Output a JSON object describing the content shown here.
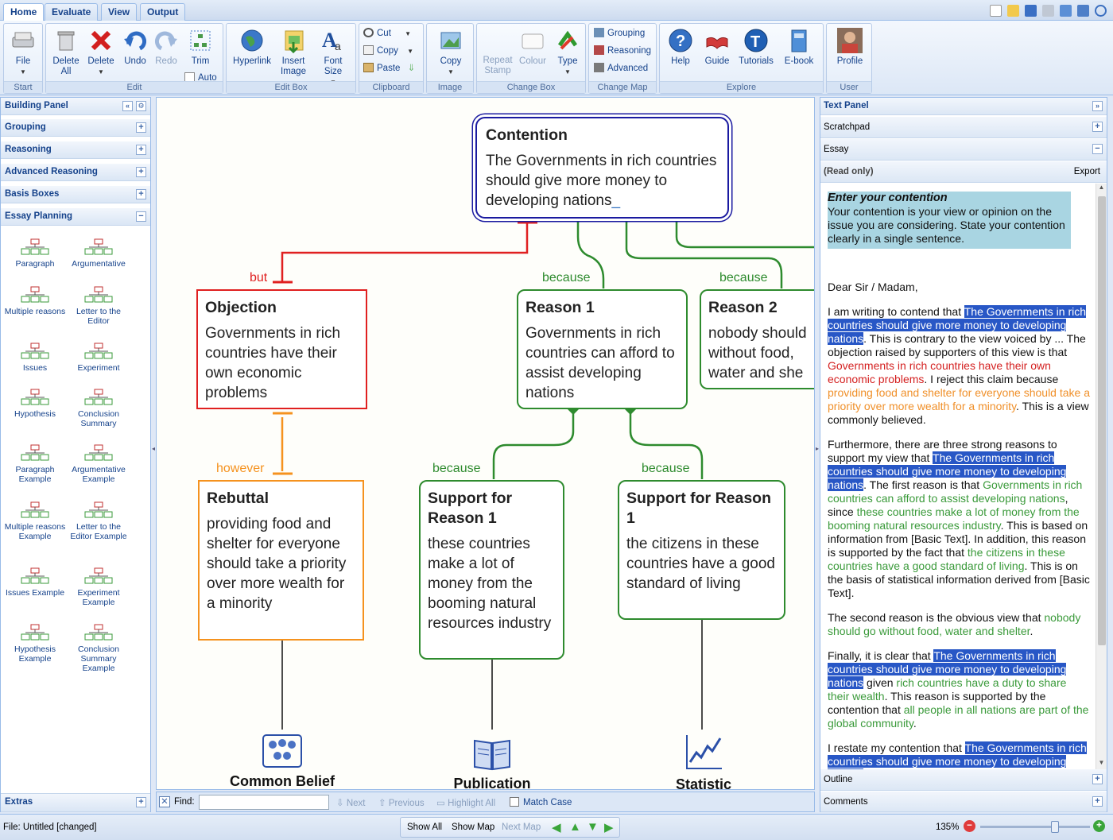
{
  "tabs": [
    "Home",
    "Evaluate",
    "View",
    "Output"
  ],
  "ribbon": {
    "start": {
      "title": "Start",
      "file": "File"
    },
    "edit": {
      "title": "Edit",
      "delete_all": "Delete All",
      "delete": "Delete",
      "undo": "Undo",
      "redo": "Redo",
      "trim": "Trim",
      "auto": "Auto"
    },
    "editbox": {
      "title": "Edit Box",
      "hyperlink": "Hyperlink",
      "insert_image": "Insert Image",
      "font_size": "Font Size"
    },
    "clipboard": {
      "title": "Clipboard",
      "cut": "Cut",
      "copy": "Copy",
      "paste": "Paste"
    },
    "image": {
      "title": "Image",
      "copy": "Copy"
    },
    "changebox": {
      "title": "Change Box",
      "repeat_stamp": "Repeat Stamp",
      "colour": "Colour",
      "type": "Type"
    },
    "changemap": {
      "title": "Change Map",
      "grouping": "Grouping",
      "reasoning": "Reasoning",
      "advanced": "Advanced"
    },
    "explore": {
      "title": "Explore",
      "help": "Help",
      "guide": "Guide",
      "tutorials": "Tutorials",
      "ebook": "E-book"
    },
    "user": {
      "title": "User",
      "profile": "Profile"
    }
  },
  "left_panel": {
    "title": "Building Panel",
    "sections": [
      "Grouping",
      "Reasoning",
      "Advanced Reasoning",
      "Basis Boxes",
      "Essay Planning"
    ],
    "templates": [
      "Paragraph",
      "Argumentative",
      "Multiple reasons",
      "Letter to the Editor",
      "Issues",
      "Experiment",
      "Hypothesis",
      "Conclusion Summary",
      "Paragraph Example",
      "Argumentative Example",
      "Multiple reasons Example",
      "Letter to the Editor Example",
      "Issues Example",
      "Experiment Example",
      "Hypothesis Example",
      "Conclusion Summary Example"
    ],
    "extras": "Extras"
  },
  "map": {
    "contention": {
      "title": "Contention",
      "text": "The Governments in rich countries should give more money to developing nations",
      "cursor": "_"
    },
    "objection": {
      "title": "Objection",
      "text": "Governments in rich countries have their own economic problems",
      "connector": "but"
    },
    "reason1": {
      "title": "Reason 1",
      "text": "Governments in rich countries can afford to assist developing nations",
      "connector": "because"
    },
    "reason2": {
      "title": "Reason 2",
      "text": "nobody should without food, water and she",
      "connector": "because"
    },
    "rebuttal": {
      "title": "Rebuttal",
      "text": "providing food and shelter for everyone should take a priority over more wealth for a minority",
      "connector": "however"
    },
    "support1": {
      "title": "Support for Reason 1",
      "text": "these countries make a lot of money from the booming natural resources industry",
      "connector": "because"
    },
    "support2": {
      "title": "Support for Reason 1",
      "text": "the citizens in these countries have a good standard of living",
      "connector": "because"
    },
    "basis": [
      "Common Belief",
      "Publication",
      "Statistic"
    ]
  },
  "findbar": {
    "find": "Find:",
    "next": "Next",
    "previous": "Previous",
    "highlight_all": "Highlight All",
    "match_case": "Match Case"
  },
  "right_panel": {
    "title": "Text Panel",
    "scratchpad": "Scratchpad",
    "essay": "Essay",
    "readonly": "(Read only)",
    "export": "Export",
    "outline": "Outline",
    "comments": "Comments",
    "prompt_title": "Enter your contention",
    "prompt_text": "Your contention is your view or opinion on the issue you are considering. State your contention clearly in a single sentence.",
    "greeting": "Dear Sir / Madam,",
    "contention_hl": "The Governments in rich countries should give more money to developing nations"
  },
  "status": {
    "file": "File: Untitled [changed]",
    "show_all": "Show All",
    "show_map": "Show Map",
    "next_map": "Next Map",
    "zoom": "135%",
    "zoom_level": 0.68
  },
  "colors": {
    "green": "#2e8b2e",
    "red": "#e02020",
    "orange": "#f5921e",
    "contention_border": "#1a1aa0",
    "highlight": "#2857c6"
  }
}
